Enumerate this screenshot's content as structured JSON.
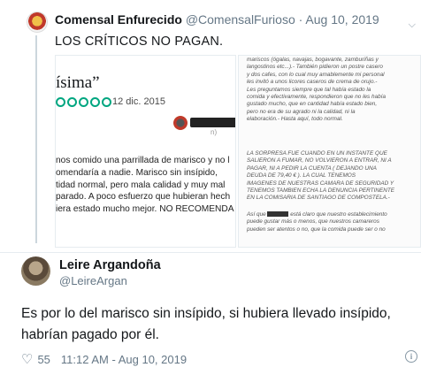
{
  "quoted_tweet": {
    "name": "Comensal Enfurecido",
    "handle": "@ComensalFurioso",
    "separator": "·",
    "date": "Aug 10, 2019",
    "text": "LOS CRÍTICOS NO PAGAN.",
    "review_screenshot": {
      "title_fragment": "ísima”",
      "rating_bubbles": 5,
      "date": "12 dic. 2015",
      "reviewer_suffix": "n)",
      "body_lines": [
        "nos comido una parrillada de marisco y no l",
        "omendaría a nadie. Marisco sin insípido,",
        "tidad normal, pero mala calidad y muy mal",
        "parado. A poco esfuerzo que hubieran hech",
        "iera estado mucho mejor. NO RECOMENDA"
      ]
    },
    "reply_screenshot": {
      "para1": [
        "mariscos (ógalas, navajas, bogavante, zamburiñas y",
        "langostinos etc...).- También pidieron un postre casero",
        "y dos cafes, con lo cual muy amablemente mi personal",
        "les invitó a unos licores caseros de crema de orujo.-",
        "Les preguntamos siempre que tal había estado la",
        "comida y efectivamente, respondieron que no les había",
        "gustado mucho, que en cantidad había estado bien,",
        "pero no era de su agrado ni la calidad, ni la",
        "elaboración.- Hasta aquí, todo normal."
      ],
      "para2": [
        "LA SORPRESA FUE CUANDO EN UN INSTANTE QUE",
        "SALIERON A FUMAR, NO VOLVIERON A ENTRAR, NI A",
        "PAGAR, NI A PEDIR LA CUENTA ( DEJANDO UNA",
        "DEUDA DE 79,40 € ). LA CUAL TENEMOS",
        "IMAGENES DE NUESTRAS CAMARA DE SEGURIDAD Y",
        "TENEMOS TAMBIEN ECHA LA DENUNCIA PERTINENTE",
        "EN LA COMISARIA DE SANTIAGO DE COMPOSTELA.-"
      ],
      "para3_prefix": "Así que",
      "para3_line1_rest": "está claro que nuestro establecimiento",
      "para3_rest": [
        "puede gustar más o menos, que nuestros camareros",
        "pueden ser atentos o no, que la comida puede ser o no"
      ]
    }
  },
  "main_tweet": {
    "name": "Leire Argandoña",
    "handle": "@LeireArgan",
    "text": "Es por lo del marisco sin insípido, si hubiera llevado insípido, habrían pagado por él.",
    "likes": "55",
    "time": "11:12 AM - Aug 10, 2019",
    "info_glyph": "i"
  },
  "colors": {
    "rating_green": "#00a680",
    "secondary_text": "#657786",
    "divider": "#e6ecf0"
  },
  "icons": {
    "heart": "heart-icon",
    "info": "info-icon",
    "chevron": "chevron-down-icon"
  }
}
